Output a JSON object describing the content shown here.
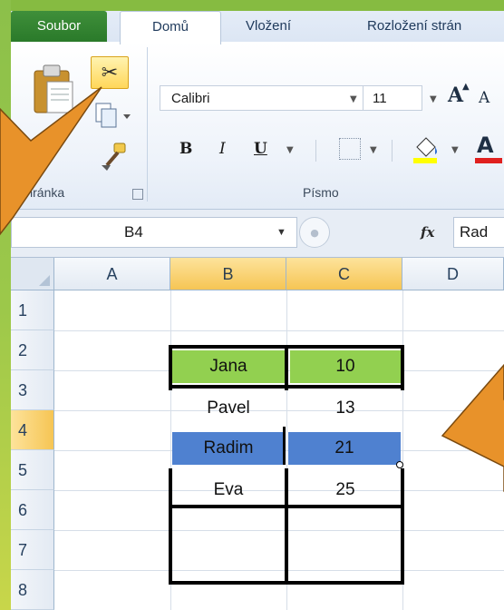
{
  "tabs": {
    "file": "Soubor",
    "home": "Domů",
    "insert": "Vložení",
    "layout": "Rozložení strán"
  },
  "ribbon": {
    "clipboard": {
      "paste_label": "zit",
      "group_label": "Schránka"
    },
    "font": {
      "font_name": "Calibri",
      "font_size": "11",
      "group_label": "Písmo",
      "bold": "B",
      "italic": "I",
      "underline": "U",
      "grow": "A",
      "shrink": "A",
      "font_color_letter": "A"
    }
  },
  "formula_bar": {
    "name_box": "B4",
    "fx": "fx",
    "value": "Rad"
  },
  "grid": {
    "columns": [
      "A",
      "B",
      "C",
      "D"
    ],
    "rows": [
      "1",
      "2",
      "3",
      "4",
      "5",
      "6",
      "7",
      "8"
    ],
    "cells": [
      {
        "name": "Jana",
        "value": "10"
      },
      {
        "name": "Pavel",
        "value": "13"
      },
      {
        "name": "Radim",
        "value": "21"
      },
      {
        "name": "Eva",
        "value": "25"
      }
    ]
  },
  "colors": {
    "highlight_green": "#92d050",
    "highlight_blue": "#4f81d0",
    "arrow": "#e8922a",
    "slide_green": "#86bb41"
  }
}
